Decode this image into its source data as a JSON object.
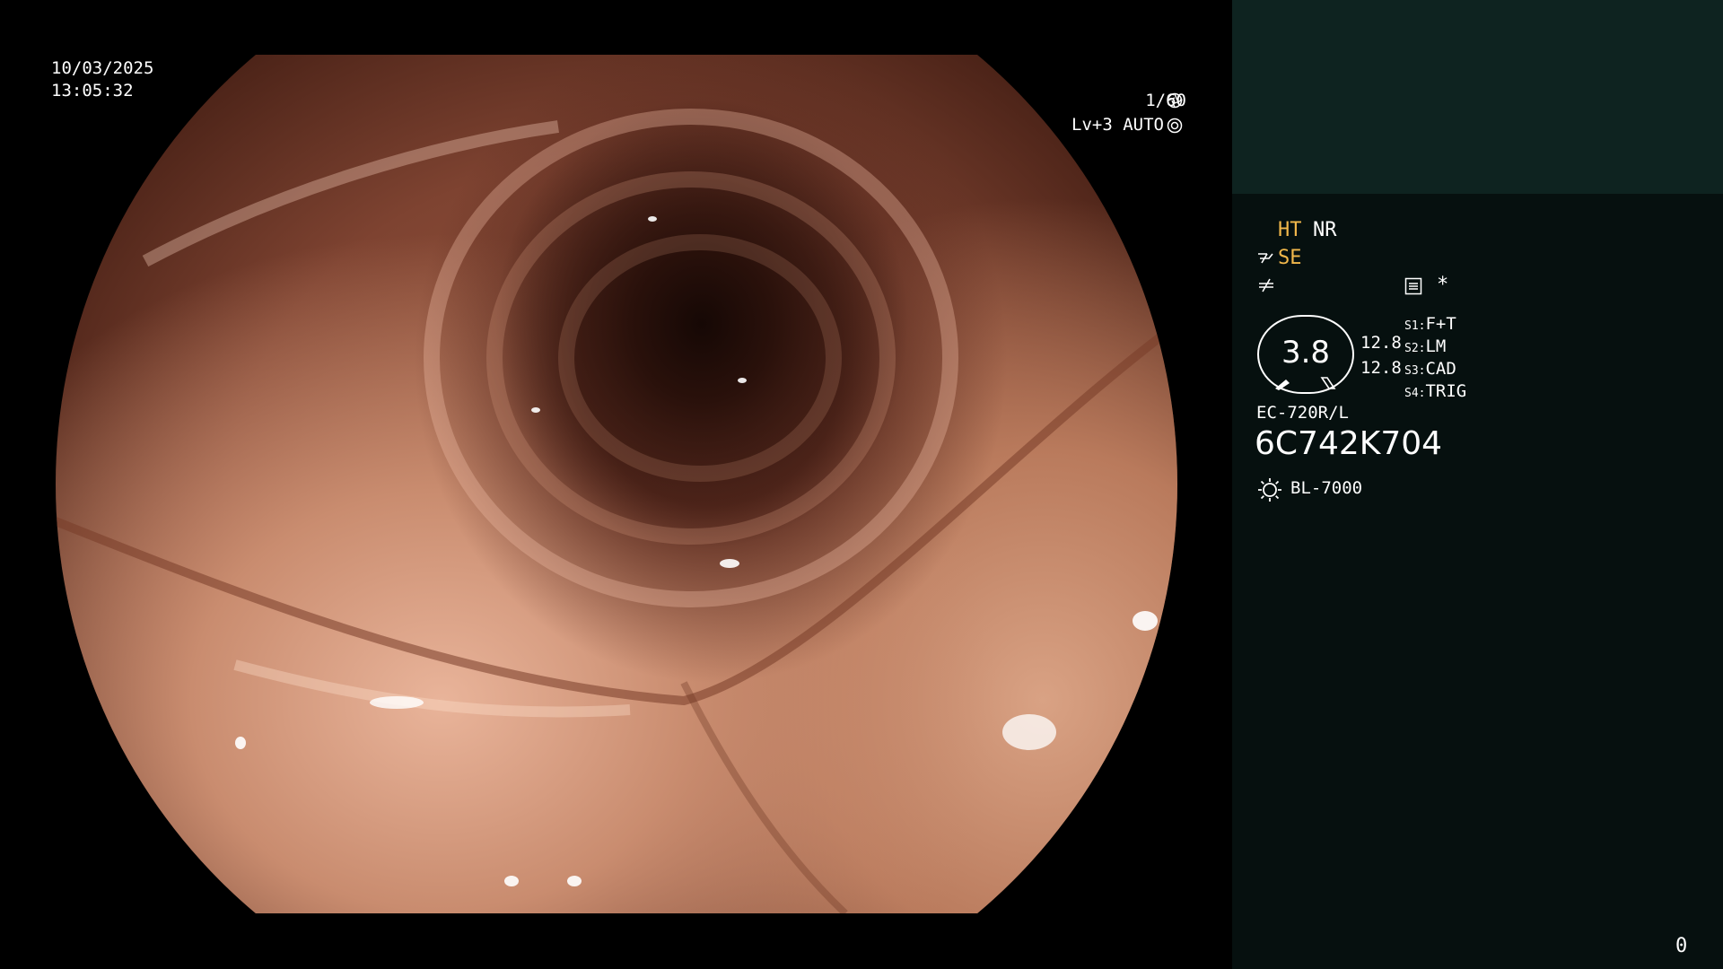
{
  "osd": {
    "date": "10/03/2025",
    "time": "13:05:32",
    "shutter": "1/60",
    "level": "Lv+3 AUTO"
  },
  "panel": {
    "ht": "HT",
    "nr": "NR",
    "se": "SE",
    "asterisk": "*",
    "gauge_value": "3.8",
    "gauge_upper": "12.8",
    "gauge_lower": "12.8",
    "switches": [
      {
        "key": "S1:",
        "value": "F+T"
      },
      {
        "key": "S2:",
        "value": "LM"
      },
      {
        "key": "S3:",
        "value": "CAD"
      },
      {
        "key": "S4:",
        "value": "TRIG"
      }
    ],
    "scope_model": "EC-720R/L",
    "serial": "6C742K704",
    "light_source": "BL-7000",
    "counter": "0"
  },
  "colors": {
    "panel_bg": "#06100f",
    "panel_top_bg": "#0e2320",
    "accent_yellow": "#f2b84b"
  },
  "icons": [
    "shutter-icon",
    "iris-icon",
    "air-water-icon",
    "structure-icon",
    "menu-icon",
    "light-source-icon"
  ]
}
